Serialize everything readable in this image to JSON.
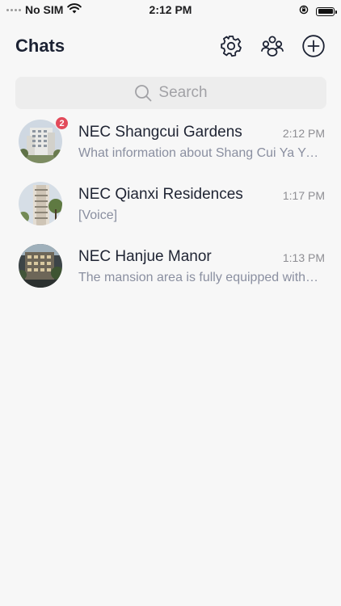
{
  "status_bar": {
    "carrier": "No SIM",
    "time": "2:12 PM"
  },
  "header": {
    "title": "Chats",
    "actions": [
      {
        "icon": "gear-icon"
      },
      {
        "icon": "contacts-icon"
      },
      {
        "icon": "plus-circle-icon"
      }
    ]
  },
  "search": {
    "placeholder": "Search"
  },
  "chats": [
    {
      "name": "NEC Shangcui Gardens",
      "time": "2:12 PM",
      "preview": "What information about Shang Cui Ya Yuan",
      "unread": "2"
    },
    {
      "name": "NEC Qianxi Residences",
      "time": "1:17 PM",
      "preview": "[Voice]"
    },
    {
      "name": "NEC Hanjue Manor",
      "time": "1:13 PM",
      "preview": "The mansion area is fully equipped with amenities"
    }
  ],
  "colors": {
    "background": "#f7f7f7",
    "badge": "#e24a5a",
    "search_bg": "#ededed",
    "secondary_text": "#8a8fa0"
  }
}
